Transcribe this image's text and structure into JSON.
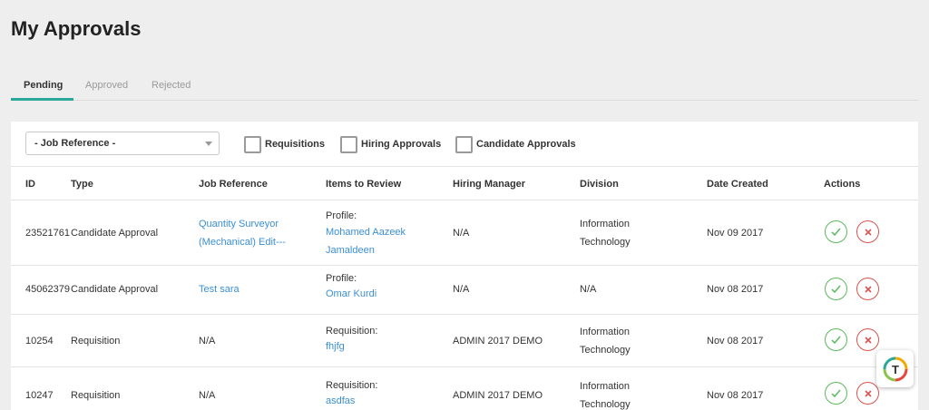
{
  "page": {
    "title": "My Approvals"
  },
  "tabs": [
    {
      "label": "Pending"
    },
    {
      "label": "Approved"
    },
    {
      "label": "Rejected"
    }
  ],
  "filters": {
    "job_reference": "- Job Reference -",
    "checkboxes": [
      {
        "label": "Requisitions"
      },
      {
        "label": "Hiring Approvals"
      },
      {
        "label": "Candidate Approvals"
      }
    ]
  },
  "table": {
    "headers": {
      "id": "ID",
      "type": "Type",
      "job_reference": "Job Reference",
      "items": "Items to Review",
      "manager": "Hiring Manager",
      "division": "Division",
      "date": "Date Created",
      "actions": "Actions"
    },
    "rows": [
      {
        "id": "23521761",
        "type": "Candidate Approval",
        "job_ref_1": "Quantity Surveyor",
        "job_ref_2": "(Mechanical) Edit---",
        "item_label": "Profile:",
        "item_1": "Mohamed Aazeek",
        "item_2": "Jamaldeen",
        "manager": "N/A",
        "division_1": "Information",
        "division_2": "Technology",
        "date": "Nov 09 2017"
      },
      {
        "id": "45062379",
        "type": "Candidate Approval",
        "job_ref_1": "Test sara",
        "item_label": "Profile:",
        "item_1": "Omar Kurdi",
        "manager": "N/A",
        "division_1": "N/A",
        "date": "Nov 08 2017"
      },
      {
        "id": "10254",
        "type": "Requisition",
        "job_ref_na": "N/A",
        "item_label": "Requisition:",
        "item_1": "fhjfg",
        "manager": "ADMIN 2017 DEMO",
        "division_1": "Information",
        "division_2": "Technology",
        "date": "Nov 08 2017"
      },
      {
        "id": "10247",
        "type": "Requisition",
        "job_ref_na": "N/A",
        "item_label": "Requisition:",
        "item_1": "asdfas",
        "manager": "ADMIN 2017 DEMO",
        "division_1": "Information",
        "division_2": "Technology",
        "date": "Nov 08 2017"
      }
    ]
  },
  "widget": {
    "letter": "T"
  },
  "colors": {
    "accent": "#2aa89a",
    "link": "#3b8fd6",
    "approve": "#5cb85c",
    "reject": "#d9534f"
  },
  "icons": {
    "approve": "check-icon",
    "reject": "x-icon",
    "caret": "chevron-down-icon"
  }
}
